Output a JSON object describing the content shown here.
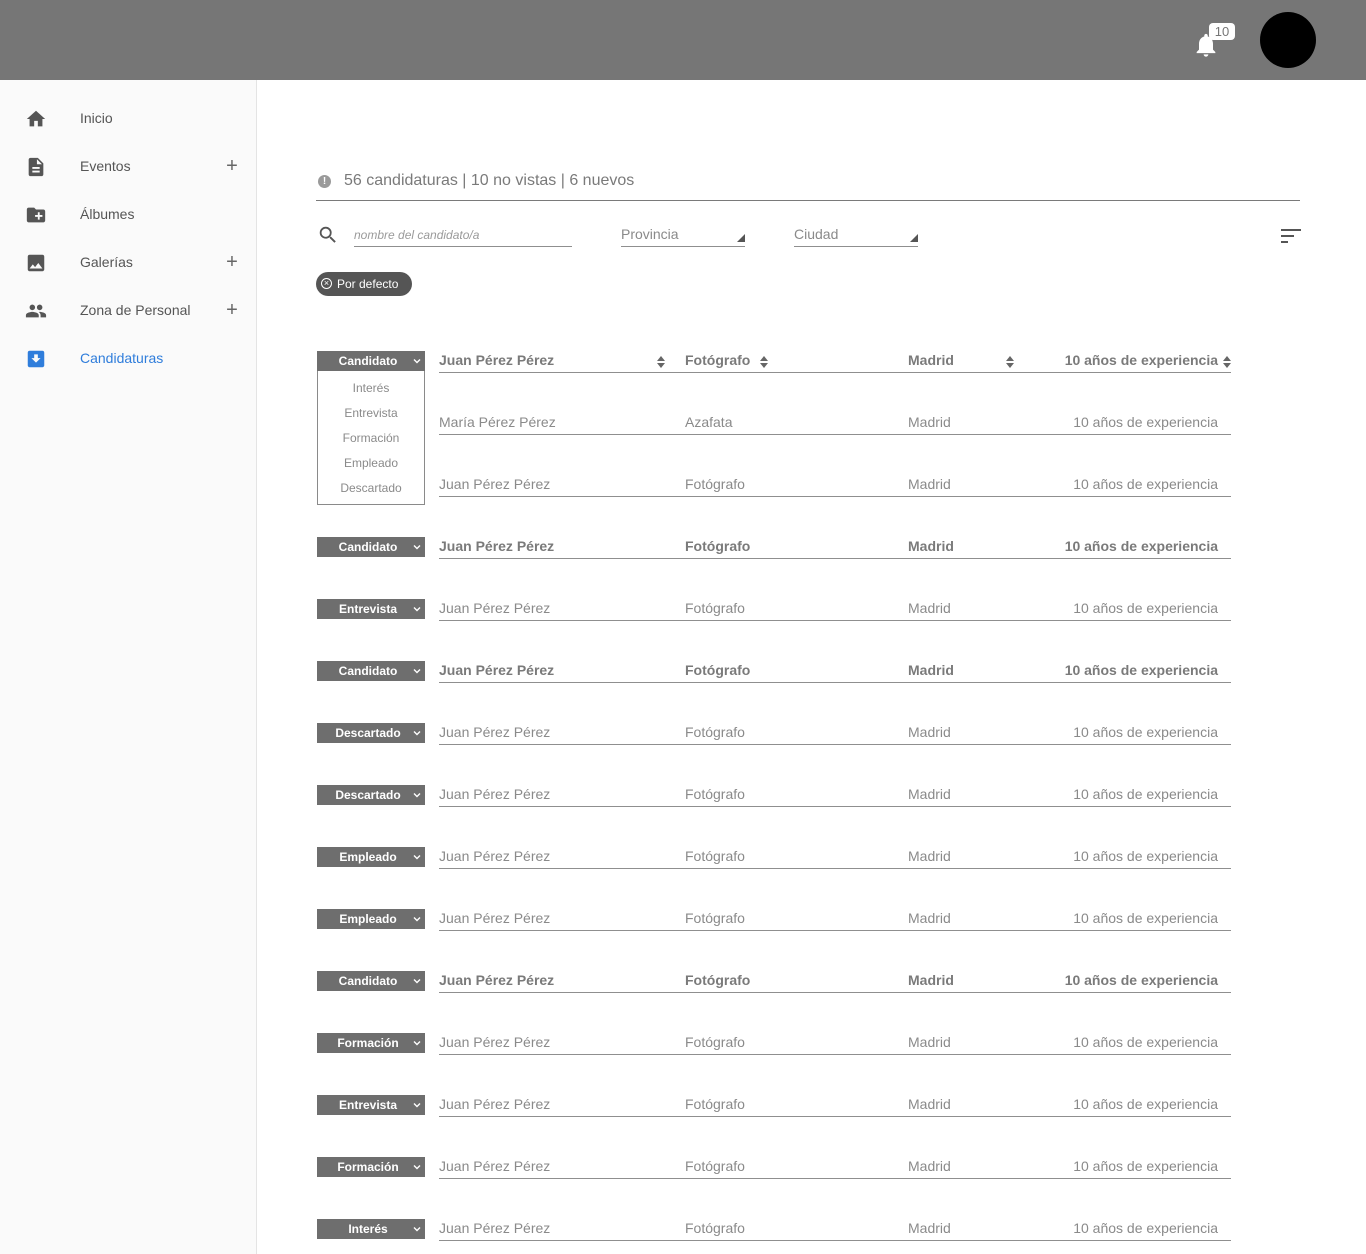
{
  "topbar": {
    "notification_count": "10",
    "bell_icon": "bell-icon",
    "avatar": "user-avatar"
  },
  "sidebar": {
    "items": [
      {
        "label": "Inicio",
        "icon": "home-icon",
        "has_add": false,
        "active": false
      },
      {
        "label": "Eventos",
        "icon": "document-icon",
        "has_add": true,
        "active": false
      },
      {
        "label": "Álbumes",
        "icon": "folder-plus-icon",
        "has_add": false,
        "active": false
      },
      {
        "label": "Galerías",
        "icon": "image-icon",
        "has_add": true,
        "active": false
      },
      {
        "label": "Zona de Personal",
        "icon": "people-icon",
        "has_add": true,
        "active": false
      },
      {
        "label": "Candidaturas",
        "icon": "inbox-download-icon",
        "has_add": false,
        "active": true
      }
    ],
    "accent_color": "#2f7ddb"
  },
  "summary": {
    "text": "56 candidaturas | 10 no vistas | 6 nuevos"
  },
  "filters": {
    "search_placeholder": "nombre del candidato/a",
    "provincia": "Provincia",
    "ciudad": "Ciudad",
    "chip_label": "Por defecto"
  },
  "dropdown": {
    "options": [
      "Interés",
      "Entrevista",
      "Formación",
      "Empleado",
      "Descartado"
    ]
  },
  "rows": [
    {
      "status": "Candidato",
      "name": "Juan Pérez Pérez",
      "role": "Fotógrafo",
      "city": "Madrid",
      "exp": "10 años de experiencia",
      "bold": true
    },
    {
      "status": "",
      "name": "María Pérez Pérez",
      "role": "Azafata",
      "city": "Madrid",
      "exp": "10 años de experiencia",
      "bold": false
    },
    {
      "status": "",
      "name": "Juan Pérez Pérez",
      "role": "Fotógrafo",
      "city": "Madrid",
      "exp": "10 años de experiencia",
      "bold": false
    },
    {
      "status": "Candidato",
      "name": "Juan Pérez Pérez",
      "role": "Fotógrafo",
      "city": "Madrid",
      "exp": "10 años de experiencia",
      "bold": true
    },
    {
      "status": "Entrevista",
      "name": "Juan Pérez Pérez",
      "role": "Fotógrafo",
      "city": "Madrid",
      "exp": "10 años de experiencia",
      "bold": false
    },
    {
      "status": "Candidato",
      "name": "Juan Pérez Pérez",
      "role": "Fotógrafo",
      "city": "Madrid",
      "exp": "10 años de experiencia",
      "bold": true
    },
    {
      "status": "Descartado",
      "name": "Juan Pérez Pérez",
      "role": "Fotógrafo",
      "city": "Madrid",
      "exp": "10 años de experiencia",
      "bold": false
    },
    {
      "status": "Descartado",
      "name": "Juan Pérez Pérez",
      "role": "Fotógrafo",
      "city": "Madrid",
      "exp": "10 años de experiencia",
      "bold": false
    },
    {
      "status": "Empleado",
      "name": "Juan Pérez Pérez",
      "role": "Fotógrafo",
      "city": "Madrid",
      "exp": "10 años de experiencia",
      "bold": false
    },
    {
      "status": "Empleado",
      "name": "Juan Pérez Pérez",
      "role": "Fotógrafo",
      "city": "Madrid",
      "exp": "10 años de experiencia",
      "bold": false
    },
    {
      "status": "Candidato",
      "name": "Juan Pérez Pérez",
      "role": "Fotógrafo",
      "city": "Madrid",
      "exp": "10 años de experiencia",
      "bold": true
    },
    {
      "status": "Formación",
      "name": "Juan Pérez Pérez",
      "role": "Fotógrafo",
      "city": "Madrid",
      "exp": "10 años de experiencia",
      "bold": false
    },
    {
      "status": "Entrevista",
      "name": "Juan Pérez Pérez",
      "role": "Fotógrafo",
      "city": "Madrid",
      "exp": "10 años de experiencia",
      "bold": false
    },
    {
      "status": "Formación",
      "name": "Juan Pérez Pérez",
      "role": "Fotógrafo",
      "city": "Madrid",
      "exp": "10 años de experiencia",
      "bold": false
    },
    {
      "status": "Interés",
      "name": "Juan Pérez Pérez",
      "role": "Fotógrafo",
      "city": "Madrid",
      "exp": "10 años de experiencia",
      "bold": false
    }
  ]
}
